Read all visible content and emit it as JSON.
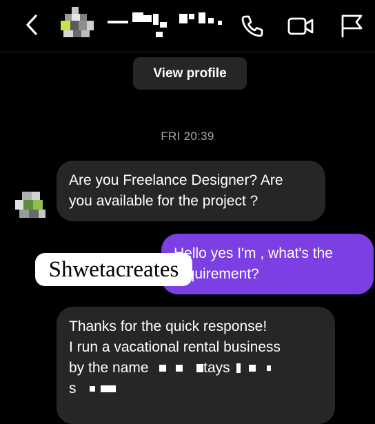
{
  "header": {
    "back_icon": "chevron-left-icon",
    "call_icon": "phone-icon",
    "video_icon": "video-camera-icon",
    "report_icon": "flag-icon"
  },
  "view_profile_label": "View profile",
  "timestamp": "FRI 20:39",
  "messages": [
    {
      "direction": "incoming",
      "lines": [
        "Are you Freelance Designer? Are",
        "you available for the project ?"
      ]
    },
    {
      "direction": "outgoing",
      "lines": [
        "Hello yes I'm , what's the",
        "requirement?"
      ]
    },
    {
      "direction": "incoming",
      "lines": [
        "Thanks for the quick response!",
        "I run a vacational rental business",
        "by the name",
        "tays",
        "s"
      ]
    }
  ],
  "watermark_text": "Shwetacreates",
  "colors": {
    "background": "#000000",
    "incoming_bubble": "#262626",
    "outgoing_bubble": "#7b3fe4",
    "timestamp": "#a8a8a8"
  }
}
